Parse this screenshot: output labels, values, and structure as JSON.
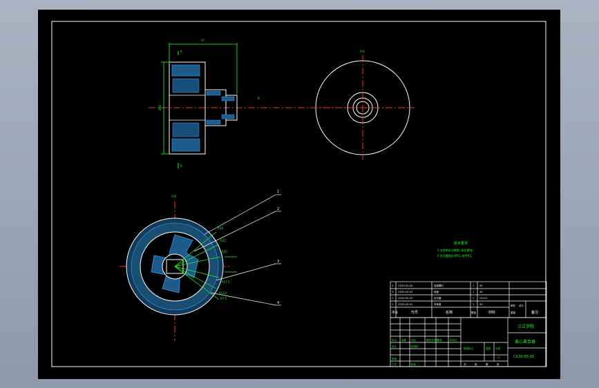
{
  "dimensions": {
    "overall_length": "37",
    "diameter": "Ø80",
    "section_label": "A",
    "view_label": "A-A",
    "view_b": "B",
    "radial_labels": [
      "R38",
      "R35",
      "R20",
      "R17.5",
      "R12.5",
      "R7.5"
    ]
  },
  "balloons": [
    "1",
    "2",
    "3",
    "4"
  ],
  "tech_requirements": {
    "title": "技术要求",
    "lines": [
      "1.去毛刺未注倒角, 锐边倒钝。",
      "2.未注圆角半径R1, 其余R2。"
    ]
  },
  "bom": {
    "rows": [
      [
        "4",
        "CG30-05-04",
        "连接螺钉",
        "1",
        "45"
      ],
      [
        "3",
        "CG30-05-03",
        "转盘",
        "1",
        "45"
      ],
      [
        "2",
        "CG30-05-02",
        "定位套",
        "1",
        "GCr15"
      ],
      [
        "1",
        "CG30-05-01",
        "本体盘",
        "1",
        "45"
      ]
    ],
    "header": {
      "seq": "序号",
      "code": "代号",
      "name": "名称",
      "qty": "数量",
      "material": "材料",
      "single": "单件",
      "total": "总计",
      "weight": "重量",
      "remark": "备注"
    }
  },
  "title_block": {
    "school": "三江学院",
    "drawing_name": "离心离合器",
    "drawing_number": "CG30-05-00",
    "cells": [
      "标记",
      "处数",
      "分区",
      "更改文件号",
      "签名",
      "年月日",
      "设计",
      "标准化",
      "审核",
      "工艺",
      "批准",
      "阶段标记",
      "重量",
      "比例",
      "共",
      "张",
      "第",
      "张",
      "1:1"
    ]
  }
}
